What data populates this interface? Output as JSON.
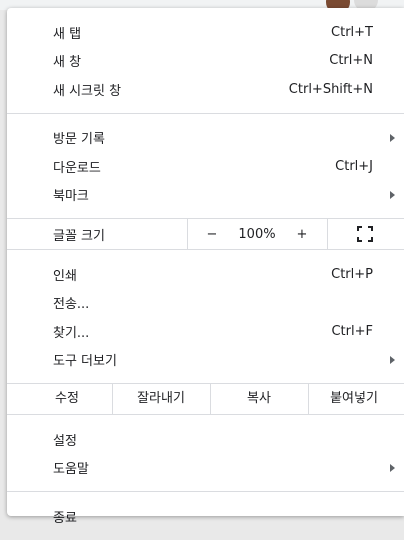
{
  "menu": {
    "group1": [
      {
        "label": "새 탭",
        "shortcut": "Ctrl+T"
      },
      {
        "label": "새 창",
        "shortcut": "Ctrl+N"
      },
      {
        "label": "새 시크릿 창",
        "shortcut": "Ctrl+Shift+N"
      }
    ],
    "group2": [
      {
        "label": "방문 기록",
        "shortcut": "",
        "submenu": true
      },
      {
        "label": "다운로드",
        "shortcut": "Ctrl+J"
      },
      {
        "label": "북마크",
        "shortcut": "",
        "submenu": true
      }
    ],
    "zoom": {
      "label": "글꼴 크기",
      "minus": "−",
      "value": "100%",
      "plus": "+",
      "fullscreen_icon": "fullscreen-icon"
    },
    "group3": [
      {
        "label": "인쇄",
        "shortcut": "Ctrl+P"
      },
      {
        "label": "전송...",
        "shortcut": ""
      },
      {
        "label": "찾기...",
        "shortcut": "Ctrl+F"
      },
      {
        "label": "도구 더보기",
        "shortcut": "",
        "submenu": true
      }
    ],
    "edit": {
      "label": "수정",
      "cut": "잘라내기",
      "copy": "복사",
      "paste": "붙여넣기"
    },
    "group4": [
      {
        "label": "설정",
        "shortcut": ""
      },
      {
        "label": "도움말",
        "shortcut": "",
        "submenu": true
      }
    ],
    "group5": [
      {
        "label": "종료",
        "shortcut": ""
      }
    ]
  },
  "colors": {
    "separator": "#dadce0",
    "text": "#202124",
    "arrow": "#5f6368"
  }
}
